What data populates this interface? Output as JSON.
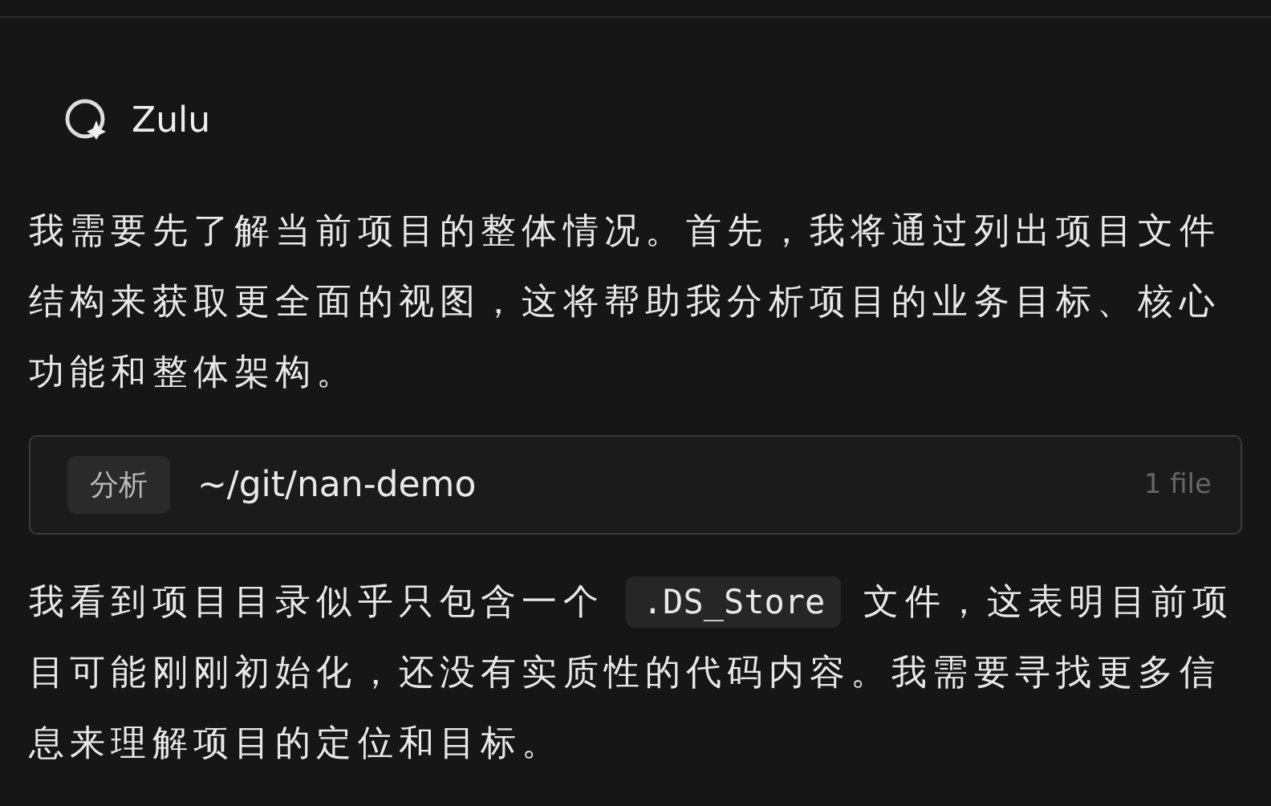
{
  "agent": {
    "name": "Zulu"
  },
  "intro": "我需要先了解当前项目的整体情况。首先，我将通过列出项目文件结构来获取更全面的视图，这将帮助我分析项目的业务目标、核心功能和整体架构。",
  "tool_call": {
    "tag": "分析",
    "path": "~/git/nan-demo",
    "count": "1 file"
  },
  "finding": {
    "before": "我看到项目目录似乎只包含一个",
    "code": ".DS_Store",
    "after": "文件，这表明目前项目可能刚刚初始化，还没有实质性的代码内容。我需要寻找更多信息来理解项目的定位和目标。"
  }
}
